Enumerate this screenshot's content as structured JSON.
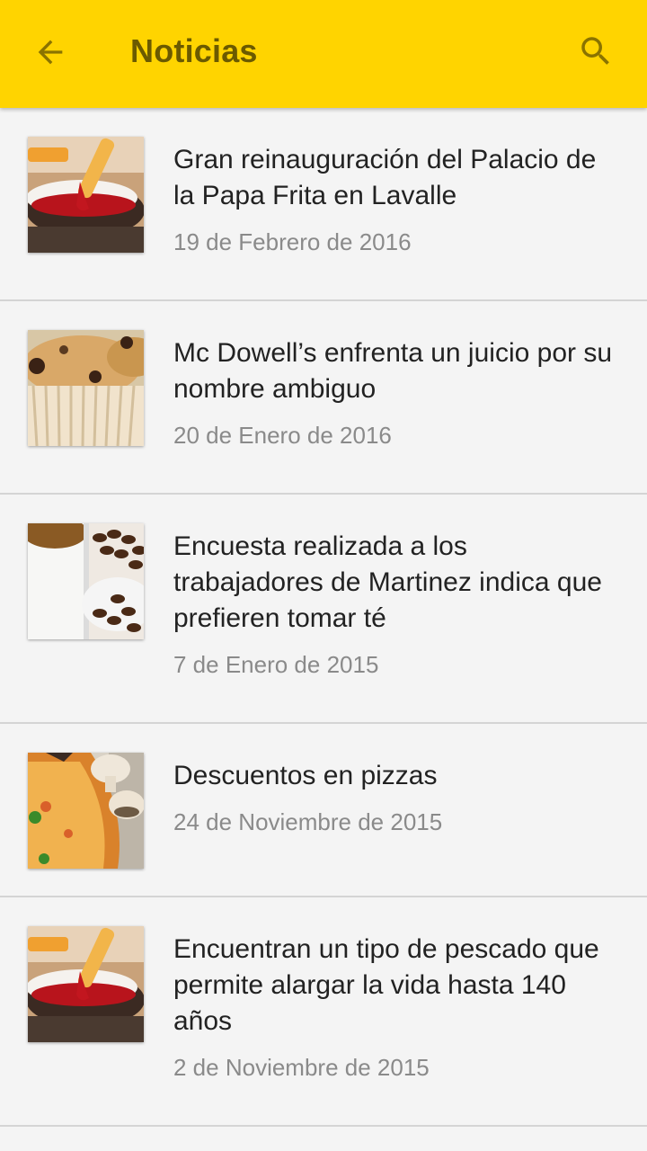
{
  "appbar": {
    "title": "Noticias",
    "background": "#ffd400",
    "back_icon": "arrow-left-icon",
    "search_icon": "search-icon"
  },
  "news": [
    {
      "title": "Gran reinauguración del Palacio de la Papa Frita en Lavalle",
      "date": "19 de Febrero de 2016",
      "thumbnail": "fries-ketchup"
    },
    {
      "title": "Mc Dowell’s enfrenta un juicio por su nombre ambiguo",
      "date": "20 de Enero de 2016",
      "thumbnail": "muffin"
    },
    {
      "title": "Encuesta realizada a los trabajadores de Martinez indica que prefieren tomar té",
      "date": "7 de Enero de 2015",
      "thumbnail": "coffee-beans"
    },
    {
      "title": "Descuentos en pizzas",
      "date": "24 de Noviembre de 2015",
      "thumbnail": "pizza-mushrooms"
    },
    {
      "title": "Encuentran un tipo de pescado que permite alargar la vida hasta 140 años",
      "date": "2 de Noviembre de 2015",
      "thumbnail": "fries-ketchup"
    }
  ]
}
